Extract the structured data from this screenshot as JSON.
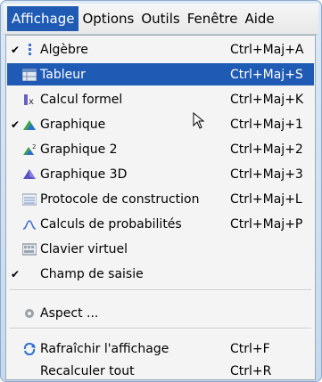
{
  "menubar": {
    "items": [
      "Affichage",
      "Options",
      "Outils",
      "Fenêtre",
      "Aide"
    ]
  },
  "menu": {
    "items": [
      {
        "label": "Algèbre",
        "shortcut": "Ctrl+Maj+A",
        "checked": true,
        "icon": "algebra-icon"
      },
      {
        "label": "Tableur",
        "shortcut": "Ctrl+Maj+S",
        "checked": false,
        "icon": "spreadsheet-icon",
        "highlighted": true
      },
      {
        "label": "Calcul formel",
        "shortcut": "Ctrl+Maj+K",
        "checked": false,
        "icon": "cas-icon"
      },
      {
        "label": "Graphique",
        "shortcut": "Ctrl+Maj+1",
        "checked": true,
        "icon": "graphics-icon"
      },
      {
        "label": "Graphique 2",
        "shortcut": "Ctrl+Maj+2",
        "checked": false,
        "icon": "graphics2-icon"
      },
      {
        "label": "Graphique 3D",
        "shortcut": "Ctrl+Maj+3",
        "checked": false,
        "icon": "graphics3d-icon"
      },
      {
        "label": "Protocole de construction",
        "shortcut": "Ctrl+Maj+L",
        "checked": false,
        "icon": "construction-protocol-icon"
      },
      {
        "label": "Calculs de probabilités",
        "shortcut": "Ctrl+Maj+P",
        "checked": false,
        "icon": "probability-icon"
      },
      {
        "label": "Clavier virtuel",
        "shortcut": "",
        "checked": false,
        "icon": "keyboard-icon"
      },
      {
        "label": "Champ de saisie",
        "shortcut": "",
        "checked": true,
        "icon": ""
      },
      {
        "label": "Aspect ...",
        "shortcut": "",
        "checked": false,
        "icon": "gear-icon"
      },
      {
        "label": "Rafraîchir l'affichage",
        "shortcut": "Ctrl+F",
        "checked": false,
        "icon": "refresh-icon"
      },
      {
        "label": "Recalculer tout",
        "shortcut": "Ctrl+R",
        "checked": false,
        "icon": ""
      }
    ],
    "check_glyph": "✔"
  },
  "colors": {
    "highlight": "#1f5bb4",
    "menu_bg": "#f4f4f4"
  }
}
